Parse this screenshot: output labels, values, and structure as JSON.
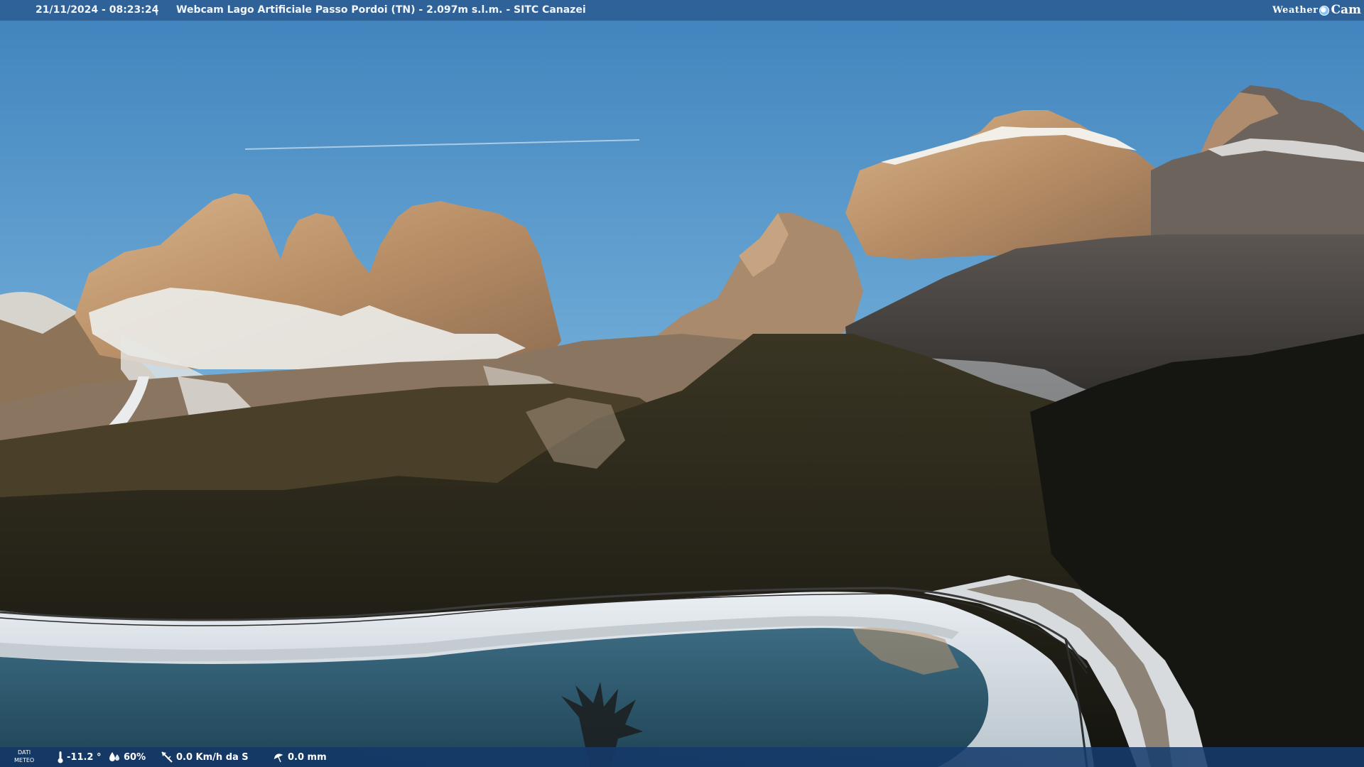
{
  "overlay": {
    "timestamp": "21/11/2024 - 08:23:24",
    "separator": "|",
    "caption": "Webcam Lago Artificiale Passo Pordoi (TN) - 2.097m s.l.m. - SITC Canazei",
    "brand": {
      "left": "Weather",
      "right": "Cam"
    }
  },
  "weather": {
    "label_line1": "DATI",
    "label_line2": "METEO",
    "temperature": "-11.2 °",
    "humidity": "60%",
    "wind": "0.0 Km/h da S",
    "rain": "0.0 mm"
  },
  "colors": {
    "sky_top": "#4f8fc3",
    "sky_bottom": "#8cc0e0",
    "rock_lit": "#c9a27a",
    "rock_shadow": "#4a4a4a",
    "forest": "#1d1d14",
    "lake": "#2f5c72",
    "snow": "#d8dde2",
    "bar": "#2d5f96"
  }
}
